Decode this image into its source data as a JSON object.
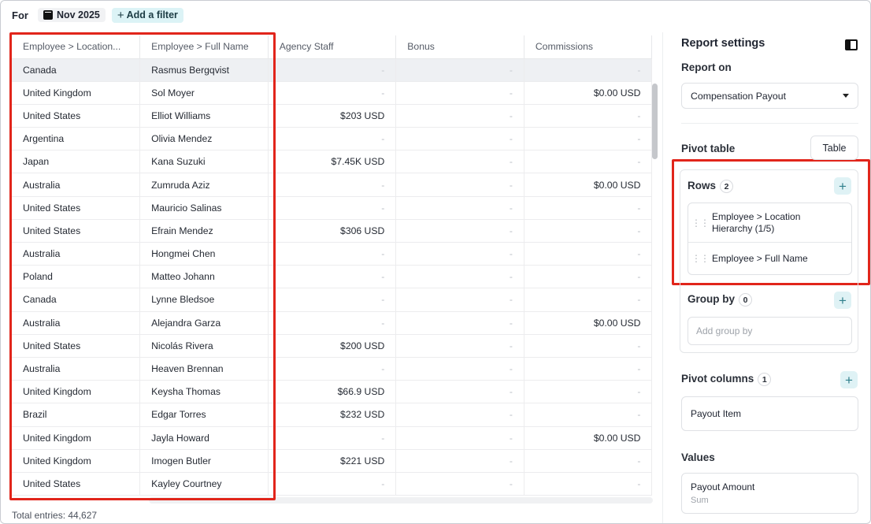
{
  "filter_bar": {
    "for_label": "For",
    "date": "Nov 2025",
    "add_filter": "Add a filter"
  },
  "table": {
    "columns": [
      "Employee > Location...",
      "Employee > Full Name",
      "Agency Staff",
      "Bonus",
      "Commissions"
    ],
    "rows": [
      [
        "Canada",
        "Rasmus Bergqvist",
        "-",
        "-",
        "-"
      ],
      [
        "United Kingdom",
        "Sol Moyer",
        "-",
        "-",
        "$0.00 USD"
      ],
      [
        "United States",
        "Elliot Williams",
        "$203 USD",
        "-",
        "-"
      ],
      [
        "Argentina",
        "Olivia Mendez",
        "-",
        "-",
        "-"
      ],
      [
        "Japan",
        "Kana Suzuki",
        "$7.45K USD",
        "-",
        "-"
      ],
      [
        "Australia",
        "Zumruda Aziz",
        "-",
        "-",
        "$0.00 USD"
      ],
      [
        "United States",
        "Mauricio Salinas",
        "-",
        "-",
        "-"
      ],
      [
        "United States",
        "Efrain Mendez",
        "$306 USD",
        "-",
        "-"
      ],
      [
        "Australia",
        "Hongmei Chen",
        "-",
        "-",
        "-"
      ],
      [
        "Poland",
        "Matteo Johann",
        "-",
        "-",
        "-"
      ],
      [
        "Canada",
        "Lynne Bledsoe",
        "-",
        "-",
        "-"
      ],
      [
        "Australia",
        "Alejandra Garza",
        "-",
        "-",
        "$0.00 USD"
      ],
      [
        "United States",
        "Nicolás Rivera",
        "$200 USD",
        "-",
        "-"
      ],
      [
        "Australia",
        "Heaven Brennan",
        "-",
        "-",
        "-"
      ],
      [
        "United Kingdom",
        "Keysha Thomas",
        "$66.9 USD",
        "-",
        "-"
      ],
      [
        "Brazil",
        "Edgar Torres",
        "$232 USD",
        "-",
        "-"
      ],
      [
        "United Kingdom",
        "Jayla Howard",
        "-",
        "-",
        "$0.00 USD"
      ],
      [
        "United Kingdom",
        "Imogen Butler",
        "$221 USD",
        "-",
        "-"
      ],
      [
        "United States",
        "Kayley Courtney",
        "-",
        "-",
        "-"
      ]
    ],
    "total_entries": "Total entries: 44,627"
  },
  "settings": {
    "title": "Report settings",
    "report_on_label": "Report on",
    "report_on_value": "Compensation Payout",
    "pivot_table_label": "Pivot table",
    "table_button": "Table",
    "rows_label": "Rows",
    "rows_count": "2",
    "rows_items": [
      "Employee > Location Hierarchy  (1/5)",
      "Employee > Full Name"
    ],
    "group_by_label": "Group by",
    "group_by_count": "0",
    "group_by_placeholder": "Add group by",
    "pivot_columns_label": "Pivot columns",
    "pivot_columns_count": "1",
    "pivot_column_item": "Payout Item",
    "values_label": "Values",
    "value_item": "Payout Amount",
    "value_sub": "Sum"
  },
  "colors": {
    "highlight_box": "#e1251b",
    "accent_button_bg": "#dff2f5",
    "accent_button_fg": "#2f7f8c"
  },
  "icons": {
    "calendar": "calendar-icon",
    "add": "plus-icon",
    "panel_toggle": "sidebar-toggle-icon",
    "drag": "drag-handle-icon",
    "dropdown": "chevron-down-icon"
  }
}
